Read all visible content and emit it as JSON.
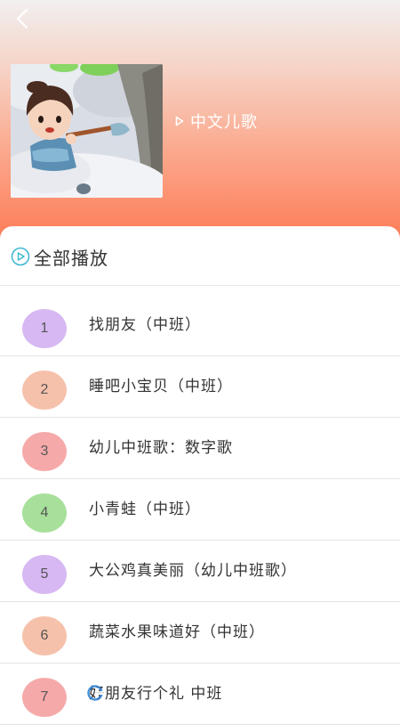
{
  "header": {
    "back_icon": "chevron-left-icon",
    "album_title": "中文儿歌",
    "album_title_icon": "play-triangle-icon",
    "colors": {
      "gradient_top": "#f1efef",
      "gradient_bottom": "#fd7a55"
    }
  },
  "play_all": {
    "label": "全部播放",
    "icon": "play-circle-icon",
    "icon_color": "#3bb6d3"
  },
  "songs": [
    {
      "num": "1",
      "name": "找朋友（中班）",
      "color": "#d7b8f2"
    },
    {
      "num": "2",
      "name": "睡吧小宝贝（中班）",
      "color": "#f6c1ab"
    },
    {
      "num": "3",
      "name": "幼儿中班歌：数字歌",
      "color": "#f6a9a9"
    },
    {
      "num": "4",
      "name": "小青蛙（中班）",
      "color": "#a7e09a"
    },
    {
      "num": "5",
      "name": "大公鸡真美丽（幼儿中班歌）",
      "color": "#d7b8f2"
    },
    {
      "num": "6",
      "name": "蔬菜水果味道好（中班）",
      "color": "#f6c1ab"
    },
    {
      "num": "7",
      "name": "好朋友行个礼 中班",
      "color": "#f6a9a9"
    }
  ]
}
